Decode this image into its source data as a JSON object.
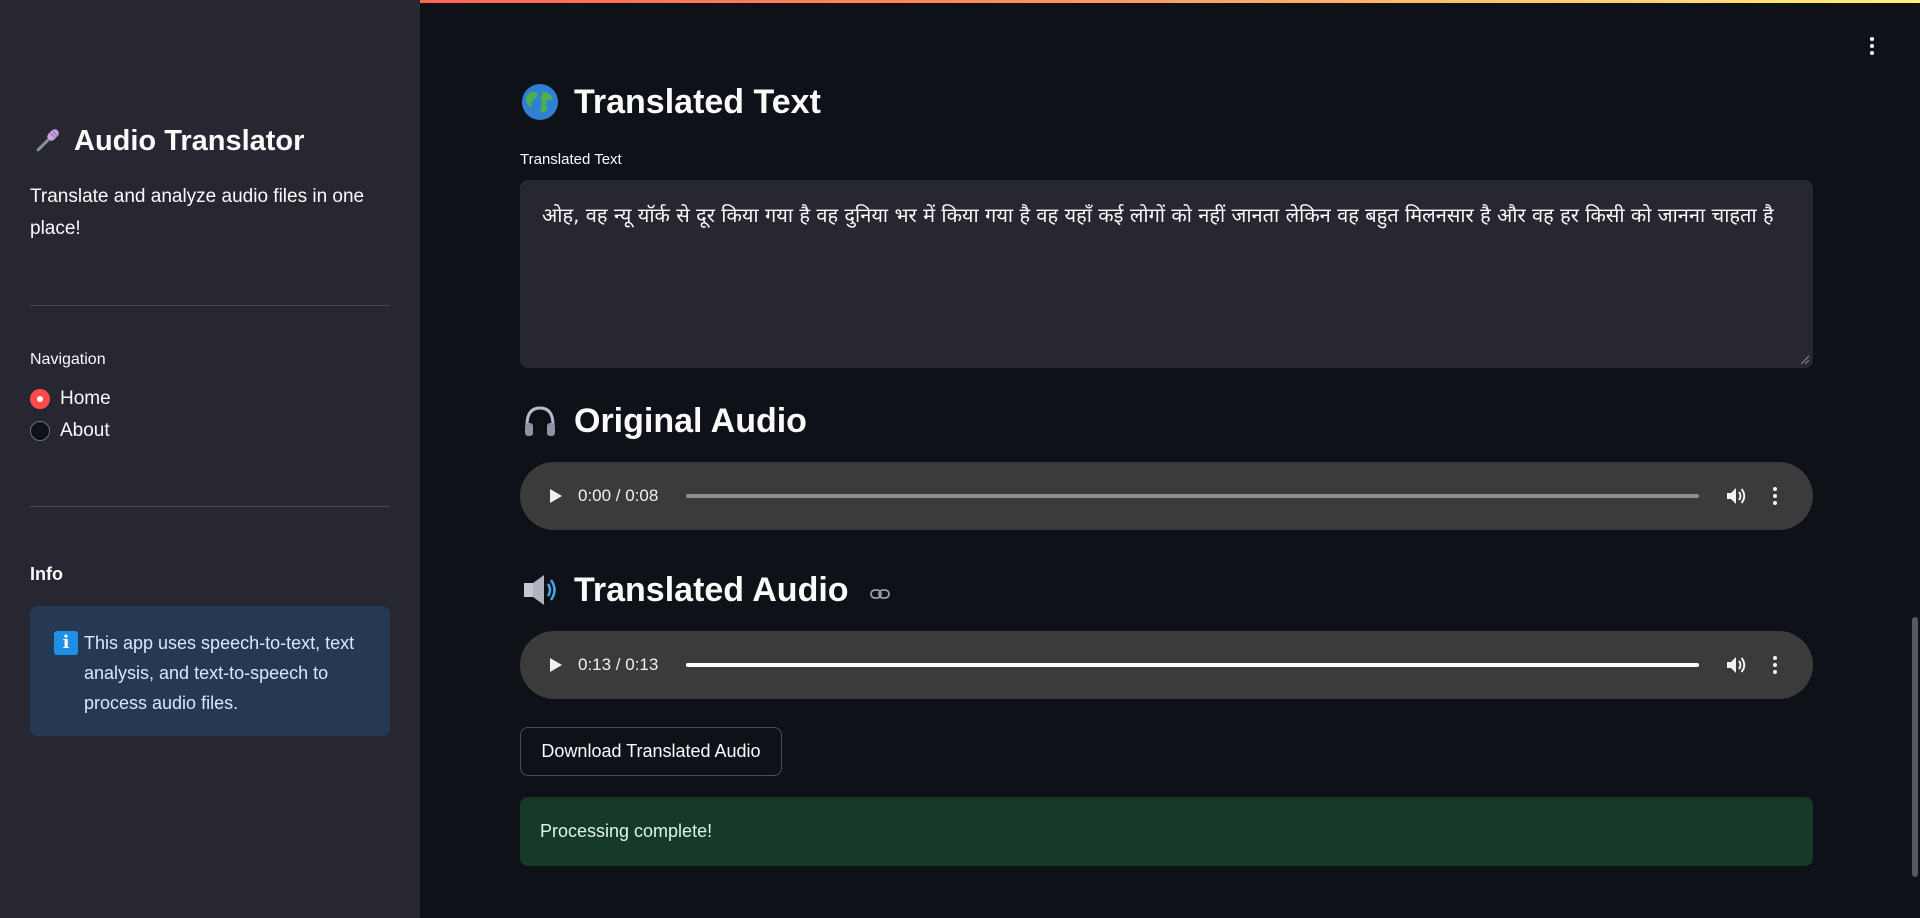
{
  "sidebar": {
    "title": "Audio Translator",
    "title_icon": "microphone-icon",
    "description": "Translate and analyze audio files in one place!",
    "navigation": {
      "label": "Navigation",
      "options": [
        {
          "label": "Home",
          "selected": true
        },
        {
          "label": "About",
          "selected": false
        }
      ]
    },
    "info": {
      "heading": "Info",
      "icon": "info-icon",
      "text": "This app uses speech-to-text, text analysis, and text-to-speech to process audio files."
    }
  },
  "main": {
    "translated_text_section": {
      "title": "Translated Text",
      "icon": "globe-icon",
      "field_label": "Translated Text",
      "value": "ओह, वह न्यू यॉर्क से दूर किया गया है वह दुनिया भर में किया गया है वह यहाँ कई लोगों को नहीं जानता लेकिन वह बहुत मिलनसार है और वह हर किसी को जानना चाहता है"
    },
    "original_audio": {
      "title": "Original Audio",
      "icon": "headphones-icon",
      "time": "0:00 / 0:08",
      "progress": 0
    },
    "translated_audio": {
      "title": "Translated Audio",
      "icon": "speaker-icon",
      "time": "0:13 / 0:13",
      "progress": 1
    },
    "download_label": "Download Translated Audio",
    "status_message": "Processing complete!"
  },
  "colors": {
    "accent": "#ff4b4b",
    "background": "#0e1117",
    "sidebar": "#262730",
    "success_bg": "#173928",
    "info_bg": "#253a52"
  }
}
